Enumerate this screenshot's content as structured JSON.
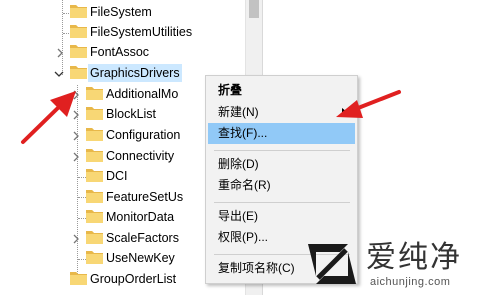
{
  "tree": {
    "items": [
      {
        "label": "FileSystem",
        "expander": "none",
        "selected": false
      },
      {
        "label": "FileSystemUtilities",
        "expander": "none",
        "selected": false
      },
      {
        "label": "FontAssoc",
        "expander": "collapsed",
        "selected": false
      },
      {
        "label": "GraphicsDrivers",
        "expander": "expanded",
        "selected": true
      },
      {
        "label": "AdditionalMo",
        "expander": "collapsed",
        "selected": false
      },
      {
        "label": "BlockList",
        "expander": "collapsed",
        "selected": false
      },
      {
        "label": "Configuration",
        "expander": "collapsed",
        "selected": false
      },
      {
        "label": "Connectivity",
        "expander": "collapsed",
        "selected": false
      },
      {
        "label": "DCI",
        "expander": "none",
        "selected": false
      },
      {
        "label": "FeatureSetUs",
        "expander": "none",
        "selected": false
      },
      {
        "label": "MonitorData",
        "expander": "none",
        "selected": false
      },
      {
        "label": "ScaleFactors",
        "expander": "collapsed",
        "selected": false
      },
      {
        "label": "UseNewKey",
        "expander": "none",
        "selected": false
      },
      {
        "label": "GroupOrderList",
        "expander": "none",
        "selected": false
      }
    ]
  },
  "context_menu": {
    "items": [
      {
        "label": "折叠",
        "bold": true,
        "highlighted": false,
        "submenu": false
      },
      {
        "label": "新建(N)",
        "bold": false,
        "highlighted": false,
        "submenu": true
      },
      {
        "label": "查找(F)...",
        "bold": false,
        "highlighted": true,
        "submenu": false
      },
      {
        "label": "删除(D)",
        "bold": false,
        "highlighted": false,
        "submenu": false
      },
      {
        "label": "重命名(R)",
        "bold": false,
        "highlighted": false,
        "submenu": false
      },
      {
        "label": "导出(E)",
        "bold": false,
        "highlighted": false,
        "submenu": false
      },
      {
        "label": "权限(P)...",
        "bold": false,
        "highlighted": false,
        "submenu": false
      },
      {
        "label": "复制项名称(C)",
        "bold": false,
        "highlighted": false,
        "submenu": false
      }
    ]
  },
  "watermark": {
    "title": "爱纯净",
    "url": "aichunjing.com"
  },
  "colors": {
    "folder": "#f8d775",
    "folder_dark": "#e8b84a",
    "selection": "#cce8ff",
    "menu_highlight": "#91c9f7",
    "menu_bg": "#f2f2f2",
    "annotation_arrow": "#e02020",
    "logo": "#1a1a1a"
  },
  "icons": {
    "folder": "folder-icon",
    "expand": "chevron-right-icon",
    "collapse": "chevron-down-icon",
    "submenu": "submenu-arrow-icon",
    "annotation": "red-arrow-icon",
    "logo": "aichunjing-logo-icon"
  }
}
